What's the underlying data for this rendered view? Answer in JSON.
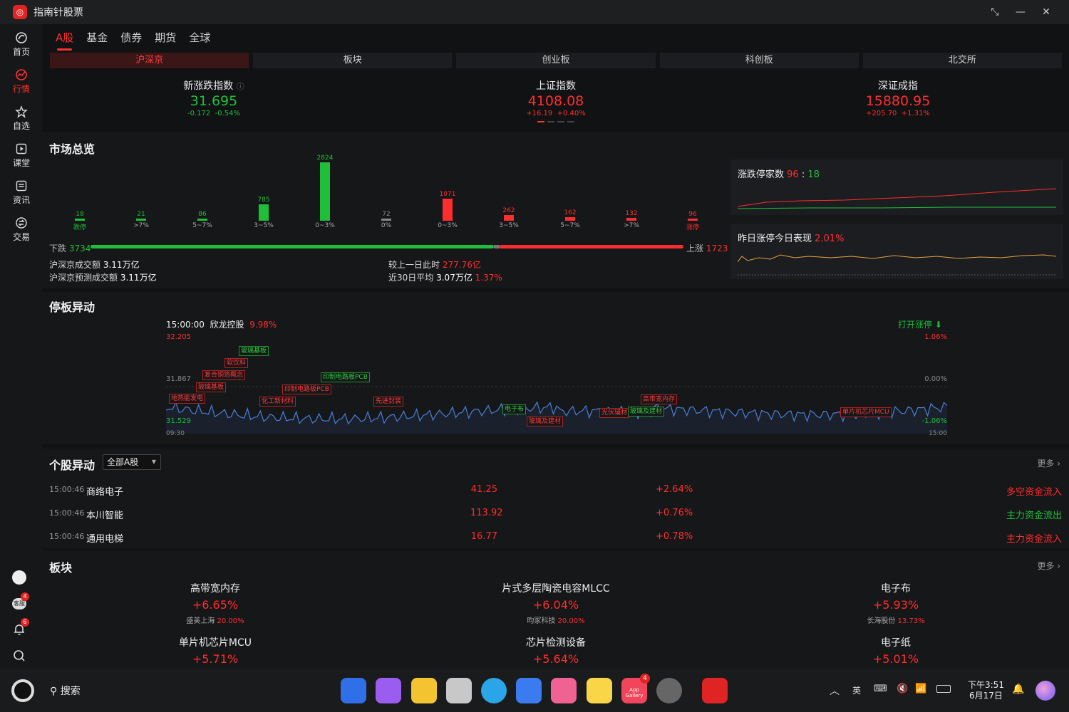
{
  "app": {
    "title": "指南针股票",
    "logo_icon": "compass-logo-icon"
  },
  "window_controls": [
    "restore-icon",
    "minimize-icon",
    "close-icon"
  ],
  "sidebar": {
    "items": [
      {
        "label": "首页",
        "icon": "home-icon"
      },
      {
        "label": "行情",
        "icon": "market-icon",
        "active": true
      },
      {
        "label": "自选",
        "icon": "star-icon"
      },
      {
        "label": "课堂",
        "icon": "play-icon"
      },
      {
        "label": "资讯",
        "icon": "news-icon"
      },
      {
        "label": "交易",
        "icon": "trade-icon"
      }
    ],
    "bottom": {
      "service_label": "客服",
      "service_badge": "4",
      "bell_badge": "6"
    }
  },
  "tabs": [
    "A股",
    "基金",
    "债券",
    "期货",
    "全球"
  ],
  "subtabs": [
    "沪深京",
    "板块",
    "创业板",
    "科创板",
    "北交所"
  ],
  "indices": [
    {
      "name": "新涨跌指数",
      "value": "31.695",
      "change": "-0.172",
      "pct": "-0.54%",
      "color": "#1fbf3a"
    },
    {
      "name": "上证指数",
      "value": "4108.08",
      "change": "+16.19",
      "pct": "+0.40%",
      "color": "#ff2d2d"
    },
    {
      "name": "深证成指",
      "value": "15880.95",
      "change": "+205.70",
      "pct": "+1.31%",
      "color": "#ff2d2d"
    }
  ],
  "market_overview": {
    "title": "市场总览",
    "chart_data": {
      "type": "bar",
      "categories": [
        "跌停",
        ">7%",
        "5~7%",
        "3~5%",
        "0~3%",
        "0%",
        "0~3%",
        "3~5%",
        "5~7%",
        ">7%",
        "涨停"
      ],
      "values": [
        18,
        21,
        86,
        785,
        2824,
        72,
        1071,
        262,
        162,
        132,
        96
      ],
      "colors": [
        "green",
        "green",
        "green",
        "green",
        "green",
        "gray",
        "red",
        "red",
        "red",
        "red",
        "red"
      ]
    },
    "down_label": "下跌",
    "down_count": "3734",
    "up_label": "上涨",
    "up_count": "1723",
    "turnover_label": "沪深京成交额",
    "turnover": "3.11万亿",
    "forecast_label": "沪深京预测成交额",
    "forecast": "3.11万亿",
    "vs_prev_label": "较上一日此时",
    "vs_prev": "277.76亿",
    "avg30_label": "近30日平均",
    "avg30": "3.07万亿",
    "avg30_pct": "1.37%",
    "limit_title": "涨跌停家数",
    "limit_up": "96",
    "limit_sep": ":",
    "limit_down": "18",
    "yday_title": "昨日涨停今日表现",
    "yday_pct": "2.01%"
  },
  "limit_board": {
    "title": "停板异动",
    "time": "15:00:00",
    "stock": "欣龙控股",
    "stock_pct": "9.98%",
    "open_label": "打开涨停",
    "y_high": "32.205",
    "y_mid": "31.867",
    "y_low": "31.529",
    "pct_high": "1.06%",
    "pct_mid": "0.00%",
    "pct_low": "-1.06%",
    "t_start": "09:30",
    "t_end": "15:00",
    "tags": [
      {
        "text": "玻璃基板",
        "c": "g"
      },
      {
        "text": "软饮料",
        "c": "r"
      },
      {
        "text": "复合铜箔概念",
        "c": "r"
      },
      {
        "text": "玻璃基板",
        "c": "r"
      },
      {
        "text": "地热能发电",
        "c": "r"
      },
      {
        "text": "化工新材料",
        "c": "r"
      },
      {
        "text": "印制电路板PCB",
        "c": "r"
      },
      {
        "text": "印制电路板PCB",
        "c": "g"
      },
      {
        "text": "先进封装",
        "c": "r"
      },
      {
        "text": "电子布",
        "c": "g"
      },
      {
        "text": "玻璃及建材",
        "c": "r"
      },
      {
        "text": "光伏辅材",
        "c": "r"
      },
      {
        "text": "玻璃及建材",
        "c": "g"
      },
      {
        "text": "高带宽内存",
        "c": "r"
      },
      {
        "text": "单片机芯片MCU",
        "c": "r"
      }
    ]
  },
  "stock_moves": {
    "title": "个股异动",
    "filter": "全部A股",
    "more": "更多 ›",
    "rows": [
      {
        "time": "15:00:46",
        "name": "商络电子",
        "price": "41.25",
        "pct": "+2.64%",
        "signal": "多空资金流入",
        "signal_color": "#ff2d2d"
      },
      {
        "time": "15:00:46",
        "name": "本川智能",
        "price": "113.92",
        "pct": "+0.76%",
        "signal": "主力资金流出",
        "signal_color": "#1fbf3a"
      },
      {
        "time": "15:00:46",
        "name": "通用电梯",
        "price": "16.77",
        "pct": "+0.78%",
        "signal": "主力资金流入",
        "signal_color": "#ff2d2d"
      }
    ]
  },
  "sectors": {
    "title": "板块",
    "more": "更多 ›",
    "items": [
      {
        "name": "高带宽内存",
        "pct": "+6.65%",
        "lead": "盛美上海",
        "lead_pct": "20.00%"
      },
      {
        "name": "片式多层陶瓷电容MLCC",
        "pct": "+6.04%",
        "lead": "昀冢科技",
        "lead_pct": "20.00%"
      },
      {
        "name": "电子布",
        "pct": "+5.93%",
        "lead": "长海股份",
        "lead_pct": "13.73%"
      },
      {
        "name": "单片机芯片MCU",
        "pct": "+5.71%",
        "lead": "",
        "lead_pct": ""
      },
      {
        "name": "芯片检测设备",
        "pct": "+5.64%",
        "lead": "",
        "lead_pct": ""
      },
      {
        "name": "电子纸",
        "pct": "+5.01%",
        "lead": "",
        "lead_pct": ""
      }
    ]
  },
  "taskbar": {
    "search_label": "搜索",
    "ime": "英",
    "time": "下午3:51",
    "date": "6月17日",
    "app_gallery_badge": "4",
    "app_gallery_label": "App Gallery"
  }
}
